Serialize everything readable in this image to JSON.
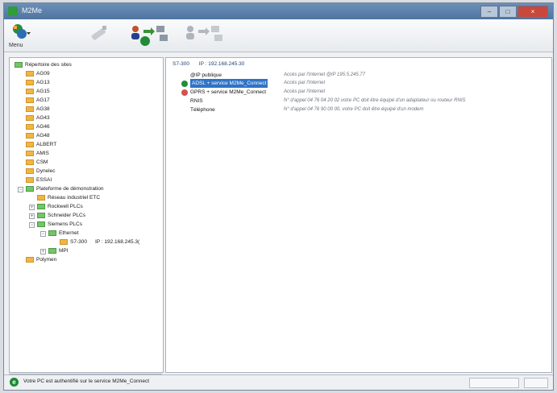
{
  "window": {
    "title": "M2Me",
    "minimize": "–",
    "maximize": "□",
    "close": "×"
  },
  "toolbar": {
    "menu_label": "Menu",
    "icons": [
      "menu-icon",
      "disconnect-icon",
      "connect-users-icon",
      "transfer-icon"
    ]
  },
  "tree": {
    "root": "Répertoire des sites",
    "items": [
      {
        "label": "AG09"
      },
      {
        "label": "AG13"
      },
      {
        "label": "AG15"
      },
      {
        "label": "AG17"
      },
      {
        "label": "AG38"
      },
      {
        "label": "AG43"
      },
      {
        "label": "AG46"
      },
      {
        "label": "AG48"
      },
      {
        "label": "ALBERT"
      },
      {
        "label": "AMIS"
      },
      {
        "label": "CSM"
      },
      {
        "label": "Dynelec"
      },
      {
        "label": "ESSAI"
      },
      {
        "label": "Plateforme de démonstration"
      },
      {
        "label": "Réseau industriel ETC"
      },
      {
        "label": "Rockwell PLCs"
      },
      {
        "label": "Schneider PLCs"
      },
      {
        "label": "Siemens PLCs"
      },
      {
        "label": "Ethernet"
      },
      {
        "label": "S7-300",
        "ip": "IP : 192.168.245.3("
      },
      {
        "label": "MPI"
      },
      {
        "label": "Polymen"
      }
    ]
  },
  "detail": {
    "header_device": "S7-300",
    "header_ip": "IP : 192.168.245.30",
    "connections": [
      {
        "label": "@IP publique",
        "desc": "Accès par l'Internet @IP 195.5.245.77"
      },
      {
        "label": "ADSL + service M2Me_Connect",
        "desc": "Accès par l'Internet"
      },
      {
        "label": "GPRS + service M2Me_Connect",
        "desc": "Accès par l'Internet"
      },
      {
        "label": "RNIS",
        "desc": "N° d'appel 04 76 04 20 02 votre PC doit être équipé d'un adaptateur ou routeur RNIS"
      },
      {
        "label": "Téléphone",
        "desc": "N° d'appel 04 76 90 00 00, votre PC doit être équipé d'un modem"
      }
    ]
  },
  "statusbar": {
    "text": "Votre PC est authentifié sur le service M2Me_Connect",
    "icon_letter": "e"
  },
  "colors": {
    "accent": "#2f73c7",
    "folder": "#f0b545",
    "green_folder": "#75c46a"
  }
}
